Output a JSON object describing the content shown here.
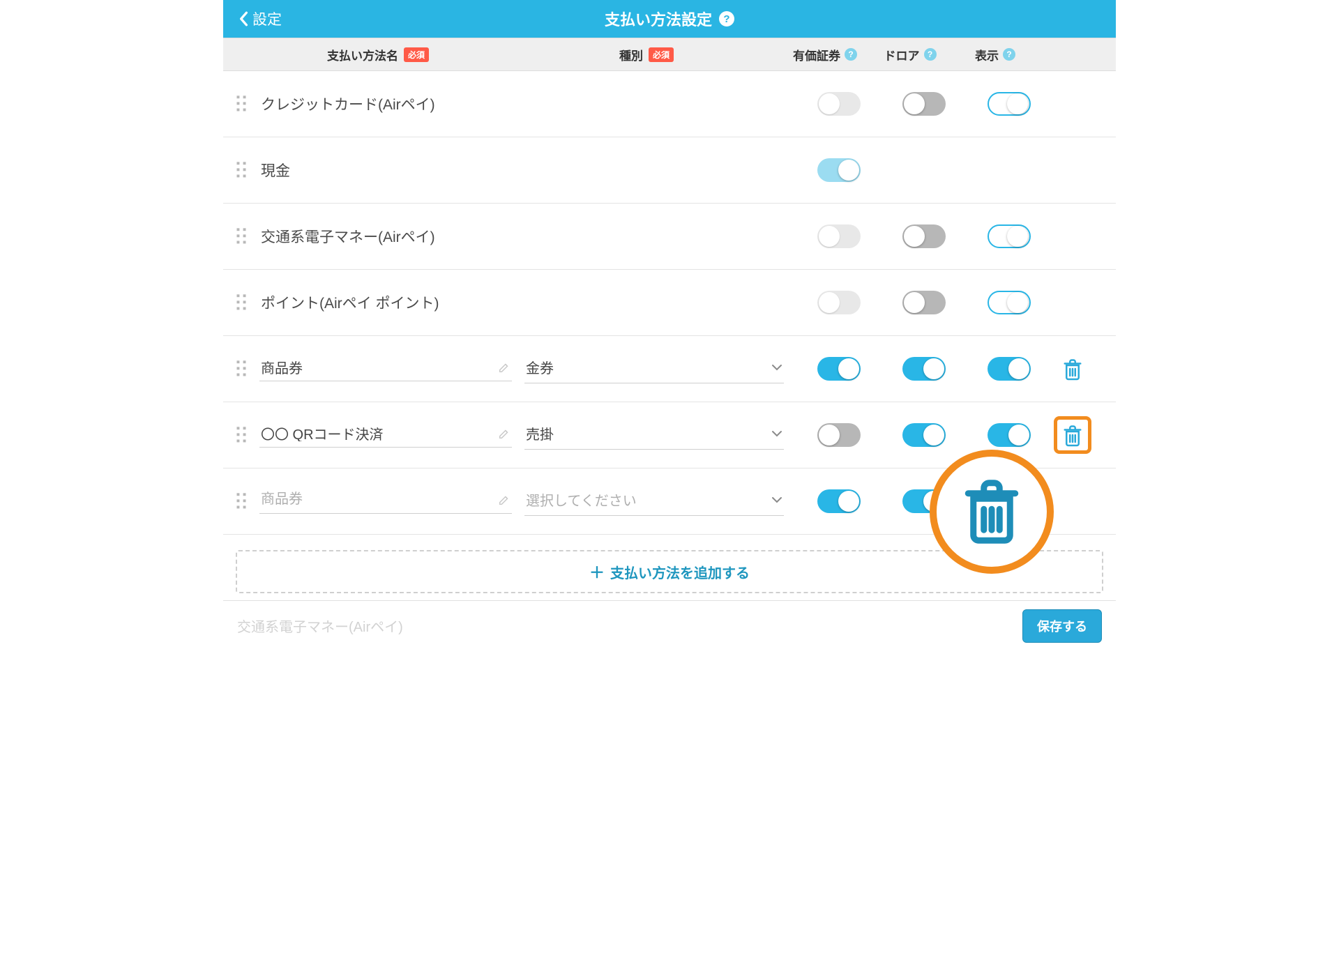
{
  "header": {
    "back_label": "設定",
    "title": "支払い方法設定"
  },
  "columns": {
    "name": "支払い方法名",
    "type": "種別",
    "securities": "有価証券",
    "drawer": "ドロア",
    "display": "表示",
    "required": "必須"
  },
  "rows": [
    {
      "kind": "static",
      "name": "クレジットカード(Airペイ)",
      "toggles": [
        "off-disabled",
        "off-gray",
        "on-blue-border"
      ]
    },
    {
      "kind": "static",
      "name": "現金",
      "toggles": [
        "on-light",
        null,
        null
      ]
    },
    {
      "kind": "static",
      "name": "交通系電子マネー(Airペイ)",
      "toggles": [
        "off-disabled",
        "off-gray",
        "on-blue-border"
      ]
    },
    {
      "kind": "static",
      "name": "ポイント(Airペイ ポイント)",
      "toggles": [
        "off-disabled",
        "off-gray",
        "on-blue-border"
      ]
    },
    {
      "kind": "edit",
      "name": "商品券",
      "type": "金券",
      "toggles": [
        "on-blue",
        "on-blue",
        "on-blue"
      ],
      "deletable": true
    },
    {
      "kind": "edit",
      "name": "〇〇 QRコード決済",
      "type": "売掛",
      "toggles": [
        "off-gray",
        "on-blue",
        "on-blue"
      ],
      "deletable": true,
      "highlight_delete": true
    },
    {
      "kind": "edit",
      "name": "",
      "placeholder": "商品券",
      "type": "",
      "type_placeholder": "選択してください",
      "toggles": [
        "on-blue",
        "on-blue",
        "on-blue"
      ],
      "deletable": false
    }
  ],
  "add_label": "支払い方法を追加する",
  "footer_ghost": "交通系電子マネー(Airペイ)",
  "save_label": "保存する"
}
